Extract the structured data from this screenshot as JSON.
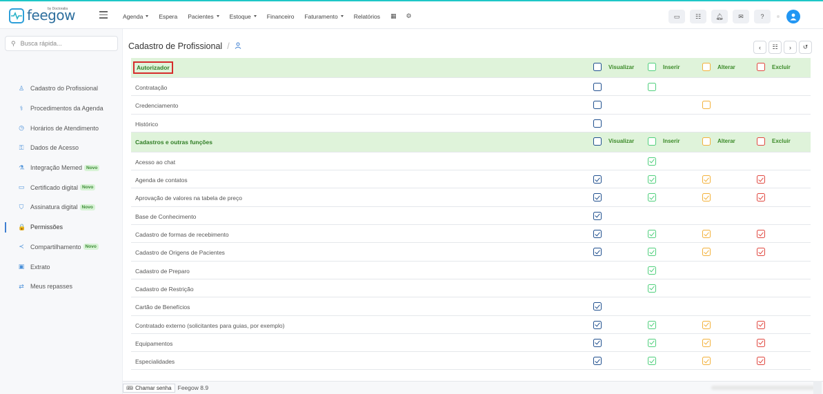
{
  "brand": {
    "name": "feegow",
    "sub": "by Doctoralia"
  },
  "nav": {
    "items": [
      {
        "label": "Agenda",
        "caret": true
      },
      {
        "label": "Espera",
        "caret": false
      },
      {
        "label": "Pacientes",
        "caret": true
      },
      {
        "label": "Estoque",
        "caret": true
      },
      {
        "label": "Financeiro",
        "caret": false
      },
      {
        "label": "Faturamento",
        "caret": true
      },
      {
        "label": "Relatórios",
        "caret": false
      }
    ]
  },
  "search": {
    "placeholder": "Busca rápida..."
  },
  "sidebar": {
    "items": [
      {
        "label": "Cadastro do Profissional",
        "icon": "user-icon",
        "glyph": "♙",
        "novo": false
      },
      {
        "label": "Procedimentos da Agenda",
        "icon": "stethoscope-icon",
        "glyph": "⚕",
        "novo": false
      },
      {
        "label": "Horários de Atendimento",
        "icon": "clock-icon",
        "glyph": "◷",
        "novo": false
      },
      {
        "label": "Dados de Acesso",
        "icon": "key-icon",
        "glyph": "⚿",
        "novo": false
      },
      {
        "label": "Integração Memed",
        "icon": "flask-icon",
        "glyph": "⚗",
        "novo": true
      },
      {
        "label": "Certificado digital",
        "icon": "card-icon",
        "glyph": "▭",
        "novo": true
      },
      {
        "label": "Assinatura digital",
        "icon": "shield-icon",
        "glyph": "⛉",
        "novo": true
      },
      {
        "label": "Permissões",
        "icon": "lock-icon",
        "glyph": "🔒",
        "novo": false,
        "active": true
      },
      {
        "label": "Compartilhamento",
        "icon": "share-icon",
        "glyph": "≺",
        "novo": true
      },
      {
        "label": "Extrato",
        "icon": "money-icon",
        "glyph": "▣",
        "novo": false
      },
      {
        "label": "Meus repasses",
        "icon": "exchange-icon",
        "glyph": "⇄",
        "novo": false
      }
    ],
    "novo_label": "Novo"
  },
  "page": {
    "title": "Cadastro de Profissional",
    "slash": "/"
  },
  "permissions": {
    "columns": [
      "Visualizar",
      "Inserir",
      "Alterar",
      "Excluir"
    ],
    "sections": [
      {
        "title": "Autorizador",
        "boxed": true,
        "rows": [
          {
            "label": "Contratação",
            "cells": [
              "empty",
              "empty",
              "none",
              "none"
            ]
          },
          {
            "label": "Credenciamento",
            "cells": [
              "empty",
              "none",
              "empty",
              "none"
            ]
          },
          {
            "label": "Histórico",
            "cells": [
              "empty",
              "none",
              "none",
              "none"
            ]
          }
        ]
      },
      {
        "title": "Cadastros e outras funções",
        "boxed": false,
        "rows": [
          {
            "label": "Acesso ao chat",
            "cells": [
              "none",
              "checked",
              "none",
              "none"
            ]
          },
          {
            "label": "Agenda de contatos",
            "cells": [
              "checked",
              "checked",
              "checked",
              "checked"
            ]
          },
          {
            "label": "Aprovação de valores na tabela de preço",
            "cells": [
              "checked",
              "checked",
              "checked",
              "checked"
            ]
          },
          {
            "label": "Base de Conhecimento",
            "cells": [
              "checked",
              "none",
              "none",
              "none"
            ]
          },
          {
            "label": "Cadastro de formas de recebimento",
            "cells": [
              "checked",
              "checked",
              "checked",
              "checked"
            ]
          },
          {
            "label": "Cadastro de Origens de Pacientes",
            "cells": [
              "checked",
              "checked",
              "checked",
              "checked"
            ]
          },
          {
            "label": "Cadastro de Preparo",
            "cells": [
              "none",
              "checked",
              "none",
              "none"
            ]
          },
          {
            "label": "Cadastro de Restrição",
            "cells": [
              "none",
              "checked",
              "none",
              "none"
            ]
          },
          {
            "label": "Cartão de Benefícios",
            "cells": [
              "checked",
              "none",
              "none",
              "none"
            ]
          },
          {
            "label": "Contratado externo (solicitantes para guias, por exemplo)",
            "cells": [
              "checked",
              "checked",
              "checked",
              "checked"
            ]
          },
          {
            "label": "Equipamentos",
            "cells": [
              "checked",
              "checked",
              "checked",
              "checked"
            ]
          },
          {
            "label": "Especialidades",
            "cells": [
              "checked",
              "checked",
              "checked",
              "checked"
            ]
          }
        ]
      }
    ]
  },
  "footer": {
    "chamar": "Chamar senha",
    "version": "Feegow 8.9"
  }
}
